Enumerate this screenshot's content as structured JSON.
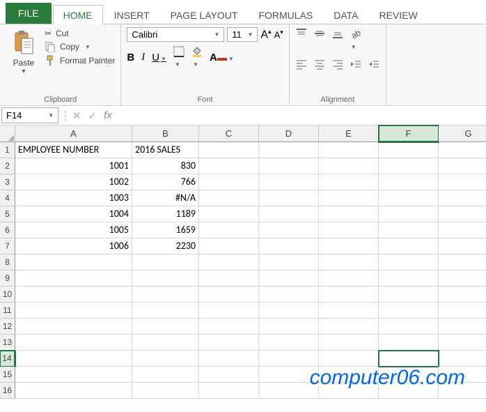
{
  "tabs": {
    "file": "FILE",
    "home": "HOME",
    "insert": "INSERT",
    "page_layout": "PAGE LAYOUT",
    "formulas": "FORMULAS",
    "data": "DATA",
    "review": "REVIEW"
  },
  "ribbon": {
    "clipboard": {
      "paste": "Paste",
      "cut": "Cut",
      "copy": "Copy",
      "format_painter": "Format Painter",
      "label": "Clipboard"
    },
    "font": {
      "name": "Calibri",
      "size": "11",
      "bold": "B",
      "italic": "I",
      "underline": "U",
      "bigA": "A",
      "smallA": "A",
      "label": "Font"
    },
    "alignment": {
      "label": "Alignment"
    }
  },
  "namebox": "F14",
  "fx": "fx",
  "formula": "",
  "columns": [
    "A",
    "B",
    "C",
    "D",
    "E",
    "F",
    "G"
  ],
  "rows": [
    "1",
    "2",
    "3",
    "4",
    "5",
    "6",
    "7",
    "8",
    "9",
    "10",
    "11",
    "12",
    "13",
    "14",
    "15",
    "16"
  ],
  "cells": {
    "header_a": "EMPLOYEE NUMBER",
    "header_b": "2016 SALES",
    "r2a": "1001",
    "r2b": "830",
    "r3a": "1002",
    "r3b": "766",
    "r4a": "1003",
    "r4b": "#N/A",
    "r5a": "1004",
    "r5b": "1189",
    "r6a": "1005",
    "r6b": "1659",
    "r7a": "1006",
    "r7b": "2230"
  },
  "selection": {
    "col": "F",
    "row": "14"
  },
  "watermark": "computer06.com"
}
